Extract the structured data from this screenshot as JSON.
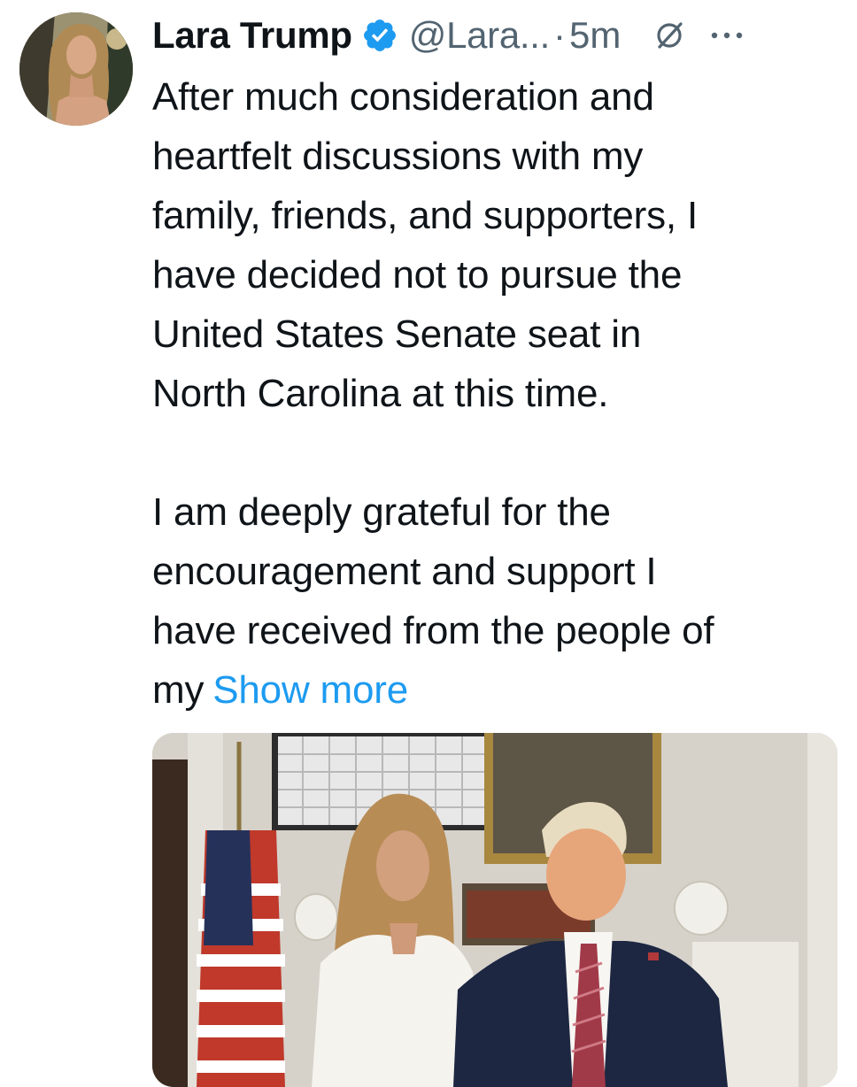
{
  "tweet": {
    "author": {
      "display_name": "Lara Trump",
      "verified_icon": "verified-badge-icon",
      "handle": "@Lara...",
      "timestamp": "5m"
    },
    "separator": "·",
    "icons": {
      "grok": "grok-icon",
      "more": "more-icon"
    },
    "text": {
      "paragraph1_lines": [
        "After much consideration and",
        "heartfelt discussions with my",
        "family, friends, and supporters, I",
        "have decided not to pursue the",
        "United States Senate seat in",
        "North Carolina at this time."
      ],
      "paragraph2_lines": [
        "I am deeply grateful for the",
        "encouragement and support I",
        "have received from the people of",
        "my"
      ],
      "show_more": "Show more"
    },
    "colors": {
      "text": "#0f1419",
      "secondary": "#536471",
      "link": "#1d9bf0",
      "verified": "#1d9bf0"
    }
  }
}
